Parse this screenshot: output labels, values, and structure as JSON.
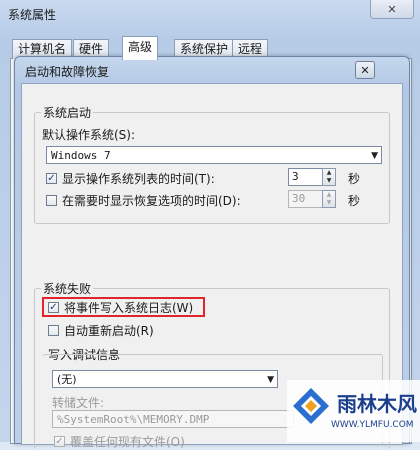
{
  "outer": {
    "title": "系统属性",
    "close_glyph": "✕",
    "tabs": [
      {
        "label": "计算机名"
      },
      {
        "label": "硬件"
      },
      {
        "label": "高级"
      },
      {
        "label": "系统保护"
      },
      {
        "label": "远程"
      }
    ],
    "active_tab": "高级"
  },
  "dialog": {
    "title": "启动和故障恢复",
    "close_glyph": "✕",
    "system_startup": {
      "group_label": "系统启动",
      "default_os_label": "默认操作系统(S):",
      "default_os_value": "Windows 7",
      "show_list": {
        "checked": true,
        "label": "显示操作系统列表的时间(T):",
        "value": "3",
        "unit": "秒"
      },
      "show_recovery": {
        "checked": false,
        "label": "在需要时显示恢复选项的时间(D):",
        "value": "30",
        "unit": "秒"
      }
    },
    "system_failure": {
      "group_label": "系统失败",
      "write_event": {
        "checked": true,
        "label": "将事件写入系统日志(W)"
      },
      "auto_restart": {
        "checked": false,
        "label": "自动重新启动(R)"
      },
      "debug_group_label": "写入调试信息",
      "debug_value": "(无)",
      "dump_file_label": "转储文件:",
      "dump_file_value": "%SystemRoot%\\MEMORY.DMP",
      "overwrite": {
        "checked": true,
        "label": "覆盖任何现有文件(O)"
      }
    }
  },
  "watermark": {
    "text": "雨林木风",
    "url": "WWW.YLMFU.COM"
  },
  "colors": {
    "highlight": "#e0262a",
    "accent": "#1b3f8e"
  }
}
